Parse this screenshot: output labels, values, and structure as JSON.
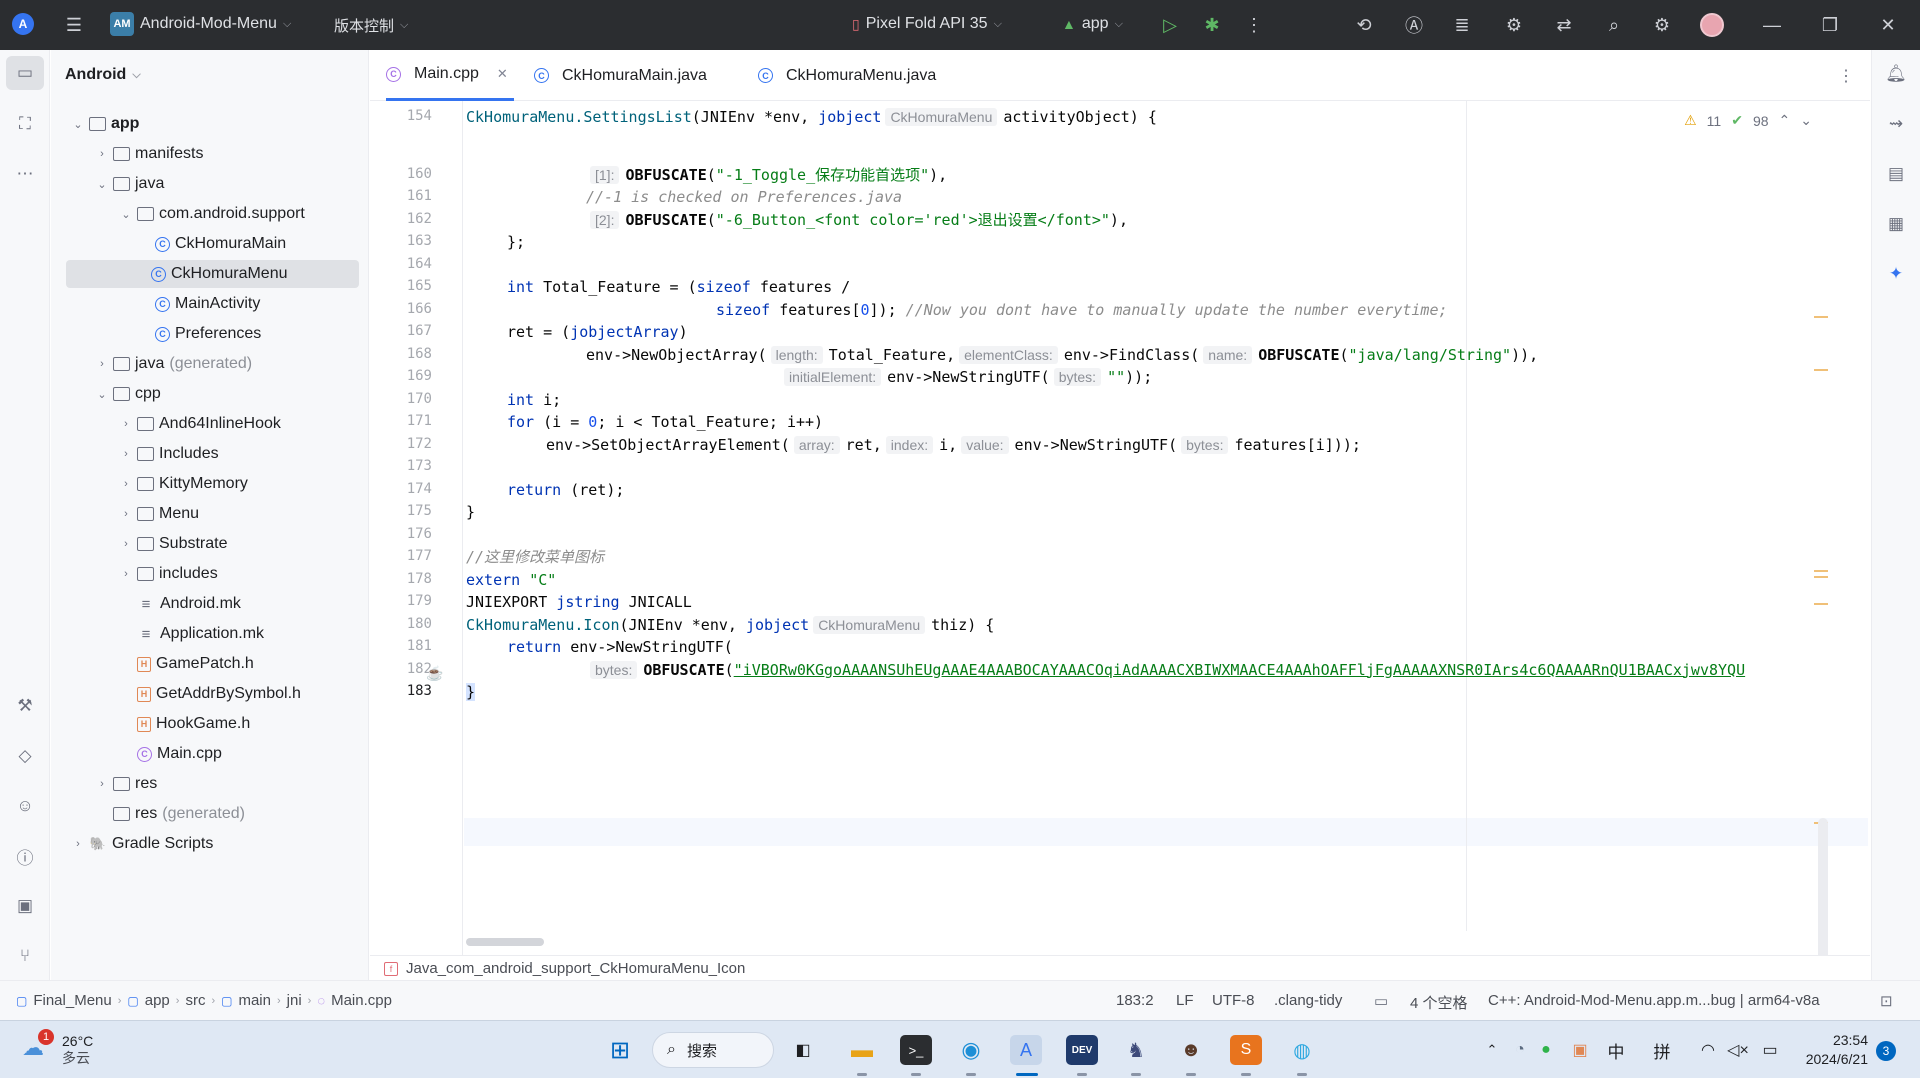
{
  "titlebar": {
    "logo": "A",
    "project_badge": "AM",
    "project_name": "Android-Mod-Menu",
    "vcs_label": "版本控制",
    "device": "Pixel Fold API 35",
    "run_config": "app"
  },
  "project_panel": {
    "view_label": "Android",
    "tree": [
      {
        "label": "app",
        "bold": true
      },
      {
        "label": "manifests"
      },
      {
        "label": "java"
      },
      {
        "label": "com.android.support"
      },
      {
        "label": "CkHomuraMain"
      },
      {
        "label": "CkHomuraMenu",
        "selected": true
      },
      {
        "label": "MainActivity"
      },
      {
        "label": "Preferences"
      },
      {
        "label": "java",
        "suffix": "(generated)"
      },
      {
        "label": "cpp"
      },
      {
        "label": "And64InlineHook"
      },
      {
        "label": "Includes"
      },
      {
        "label": "KittyMemory"
      },
      {
        "label": "Menu"
      },
      {
        "label": "Substrate"
      },
      {
        "label": "includes"
      },
      {
        "label": "Android.mk"
      },
      {
        "label": "Application.mk"
      },
      {
        "label": "GamePatch.h"
      },
      {
        "label": "GetAddrBySymbol.h"
      },
      {
        "label": "HookGame.h"
      },
      {
        "label": "Main.cpp"
      },
      {
        "label": "res"
      },
      {
        "label": "res",
        "suffix": "(generated)"
      },
      {
        "label": "Gradle Scripts"
      }
    ]
  },
  "tabs": [
    {
      "label": "Main.cpp",
      "active": true
    },
    {
      "label": "CkHomuraMain.java"
    },
    {
      "label": "CkHomuraMenu.java"
    }
  ],
  "inspections": {
    "warnings": "11",
    "ok": "98"
  },
  "line_numbers": [
    "154",
    "160",
    "161",
    "162",
    "163",
    "164",
    "165",
    "166",
    "167",
    "168",
    "169",
    "170",
    "171",
    "172",
    "173",
    "174",
    "175",
    "176",
    "177",
    "178",
    "179",
    "180",
    "181",
    "182",
    "183"
  ],
  "code": {
    "l154_a": "CkHomuraMenu.SettingsList",
    "l154_b": "(JNIEnv *env, ",
    "l154_c": "jobject",
    "l154_hint": "CkHomuraMenu",
    "l154_d": "activityObject) {",
    "l160_hint": "[1]:",
    "l160_a": "OBFUSCATE",
    "l160_b": "(",
    "l160_s": "\"-1_Toggle_保存功能首选项\"",
    "l160_c": "),",
    "l161": "//-1 is checked on Preferences.java",
    "l162_hint": "[2]:",
    "l162_a": "OBFUSCATE",
    "l162_b": "(",
    "l162_s": "\"-6_Button_<font color='red'>退出设置</font>\"",
    "l162_c": "),",
    "l163": "};",
    "l165_kw": "int",
    "l165_a": " Total_Feature = (",
    "l165_kw2": "sizeof",
    "l165_b": " features /",
    "l166_kw": "sizeof",
    "l166_a": " features[",
    "l166_n": "0",
    "l166_b": "]); ",
    "l166_cmt": "//Now you dont have to manually update the number everytime;",
    "l167_a": "ret = (",
    "l167_kw": "jobjectArray",
    "l167_b": ")",
    "l168_a": "env->NewObjectArray(",
    "l168_h1": "length:",
    "l168_b": "Total_Feature,",
    "l168_h2": "elementClass:",
    "l168_c": "env->FindClass(",
    "l168_h3": "name:",
    "l168_d": "OBFUSCATE",
    "l168_e": "(",
    "l168_s": "\"java/lang/String\"",
    "l168_f": ")),",
    "l169_h": "initialElement:",
    "l169_a": "env->NewStringUTF(",
    "l169_h2": "bytes:",
    "l169_s": "\"\"",
    "l169_b": "));",
    "l170_kw": "int",
    "l170_a": " i;",
    "l171_kw": "for",
    "l171_a": " (i = ",
    "l171_n": "0",
    "l171_b": "; i < Total_Feature; i++)",
    "l172_a": "env->SetObjectArrayElement(",
    "l172_h1": "array:",
    "l172_b": "ret,",
    "l172_h2": "index:",
    "l172_c": "i,",
    "l172_h3": "value:",
    "l172_d": "env->NewStringUTF(",
    "l172_h4": "bytes:",
    "l172_e": "features[i]));",
    "l174_kw": "return",
    "l174_a": " (ret);",
    "l175": "}",
    "l177": "//这里修改菜单图标",
    "l178_kw": "extern",
    "l178_s": "\"C\"",
    "l179_a": "JNIEXPORT",
    "l179_kw": "jstring",
    "l179_b": "JNICALL",
    "l180_a": "CkHomuraMenu.Icon",
    "l180_b": "(JNIEnv *env, ",
    "l180_kw": "jobject",
    "l180_hint": "CkHomuraMenu",
    "l180_c": "thiz) {",
    "l181_kw": "return",
    "l181_a": " env->NewStringUTF(",
    "l182_h": "bytes:",
    "l182_a": "OBFUSCATE",
    "l182_b": "(",
    "l182_s": "\"iVBORw0KGgoAAAANSUhEUgAAAE4AAABOCAYAAACOqiAdAAAACXBIWXMAACE4AAAhOAFFljFgAAAAAXNSR0IArs4c6QAAAARnQU1BAACxjwv8YQU",
    "l183": "}"
  },
  "function_breadcrumb": "Java_com_android_support_CkHomuraMenu_Icon",
  "statusbar": {
    "path": [
      "Final_Menu",
      "app",
      "src",
      "main",
      "jni",
      "Main.cpp"
    ],
    "position": "183:2",
    "line_sep": "LF",
    "encoding": "UTF-8",
    "linter": ".clang-tidy",
    "indent": "4 个空格",
    "context": "C++: Android-Mod-Menu.app.m...bug | arm64-v8a"
  },
  "taskbar": {
    "weather_temp": "26°C",
    "weather_desc": "多云",
    "weather_badge": "1",
    "search_label": "搜索",
    "ime_lang": "中",
    "ime_mode": "拼",
    "time": "23:54",
    "date": "2024/6/21",
    "notif_count": "3"
  },
  "colors": {
    "accent": "#3574f0",
    "titlebar": "#2b2d30"
  }
}
